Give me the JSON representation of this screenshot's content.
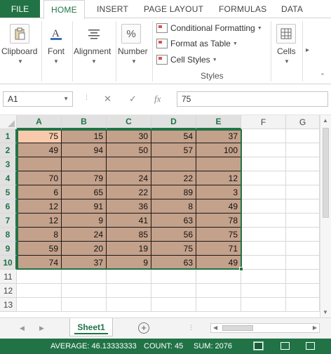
{
  "ribbon_tabs": {
    "file": "FILE",
    "items": [
      "HOME",
      "INSERT",
      "PAGE LAYOUT",
      "FORMULAS",
      "DATA"
    ],
    "active": "HOME"
  },
  "ribbon": {
    "clipboard": "Clipboard",
    "font": "Font",
    "alignment": "Alignment",
    "number": "Number",
    "number_symbol": "%",
    "conditional_formatting": "Conditional Formatting",
    "format_as_table": "Format as Table",
    "cell_styles": "Cell Styles",
    "styles_group": "Styles",
    "cells": "Cells"
  },
  "formula_bar": {
    "name_box": "A1",
    "fx": "fx",
    "value": "75"
  },
  "grid": {
    "columns": [
      "A",
      "B",
      "C",
      "D",
      "E",
      "F",
      "G"
    ],
    "rows": [
      "1",
      "2",
      "3",
      "4",
      "5",
      "6",
      "7",
      "8",
      "9",
      "10",
      "11",
      "12",
      "13"
    ],
    "data": [
      [
        "75",
        "15",
        "30",
        "54",
        "37"
      ],
      [
        "49",
        "94",
        "50",
        "57",
        "100"
      ],
      [
        "",
        "",
        "",
        "",
        ""
      ],
      [
        "70",
        "79",
        "24",
        "22",
        "12"
      ],
      [
        "6",
        "65",
        "22",
        "89",
        "3"
      ],
      [
        "12",
        "91",
        "36",
        "8",
        "49"
      ],
      [
        "12",
        "9",
        "41",
        "63",
        "78"
      ],
      [
        "8",
        "24",
        "85",
        "56",
        "75"
      ],
      [
        "59",
        "20",
        "19",
        "75",
        "71"
      ],
      [
        "74",
        "37",
        "9",
        "63",
        "49"
      ]
    ],
    "fill_color": "#c4a18b",
    "active_cell_color": "#f9c9ab"
  },
  "sheets": {
    "tabs": [
      "Sheet1"
    ],
    "active": "Sheet1",
    "add": "+"
  },
  "status": {
    "average": "AVERAGE: 46.13333333",
    "count": "COUNT: 45",
    "sum": "SUM: 2076"
  },
  "accent_color": "#217346"
}
